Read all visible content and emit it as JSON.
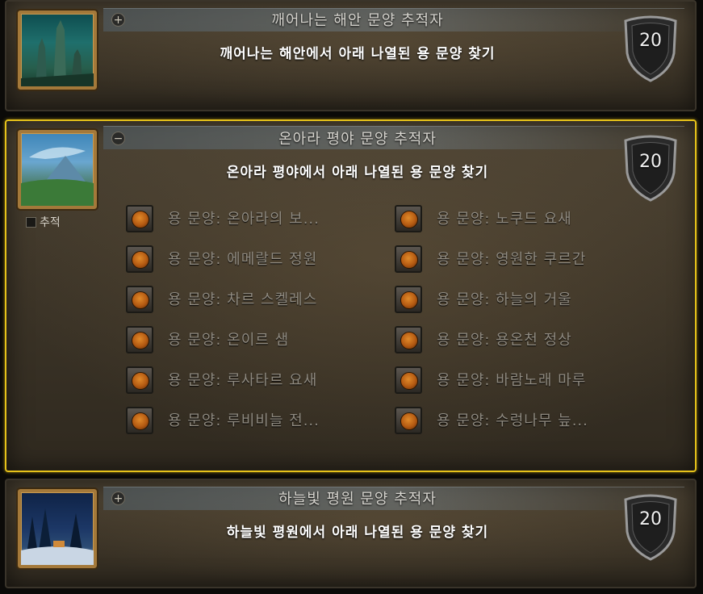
{
  "zones": [
    {
      "title": "깨어나는 해안 문양 추적자",
      "subtitle": "깨어나는 해안에서 아래 나열된 용 문양 찾기",
      "points": "20",
      "toggle": "+"
    },
    {
      "title": "온아라 평야 문양 추적자",
      "subtitle": "온아라 평야에서 아래 나열된 용 문양 찾기",
      "points": "20",
      "toggle": "−",
      "track_label": "추적",
      "criteria_left": [
        "용 문양: 온아라의 보...",
        "용 문양: 에메랄드 정원",
        "용 문양: 차르 스켈레스",
        "용 문양: 온이르 샘",
        "용 문양: 루사타르 요새",
        "용 문양: 루비비늘 전..."
      ],
      "criteria_right": [
        "용 문양: 노쿠드 요새",
        "용 문양: 영원한 쿠르간",
        "용 문양: 하늘의 거울",
        "용 문양: 용온천 정상",
        "용 문양: 바람노래 마루",
        "용 문양: 수렁나무 늪..."
      ]
    },
    {
      "title": "하늘빛 평원 문양 추적자",
      "subtitle": "하늘빛 평원에서 아래 나열된 용 문양 찾기",
      "points": "20",
      "toggle": "+"
    }
  ],
  "colors": {
    "selected_border": "#e6c21a",
    "criteria_text": "#8f8a80",
    "thumb_frame": "#a4793a"
  }
}
